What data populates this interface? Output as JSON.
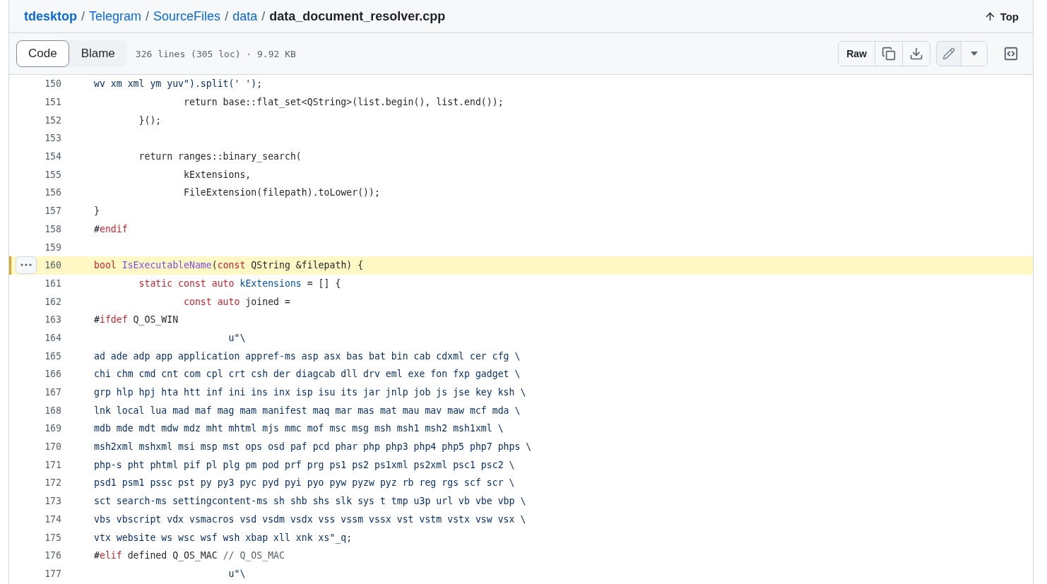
{
  "breadcrumb": {
    "items": [
      {
        "label": "tdesktop",
        "kind": "repo"
      },
      {
        "label": "Telegram",
        "kind": "link"
      },
      {
        "label": "SourceFiles",
        "kind": "link"
      },
      {
        "label": "data",
        "kind": "link"
      }
    ],
    "separator": "/",
    "file": "data_document_resolver.cpp"
  },
  "top_link": "Top",
  "view_tabs": [
    {
      "label": "Code",
      "selected": true
    },
    {
      "label": "Blame",
      "selected": false
    }
  ],
  "file_info": "326 lines (305 loc) · 9.92 KB",
  "raw_button": "Raw",
  "lines": [
    {
      "number": "150",
      "selected": false,
      "tokens": [
        {
          "kind": "string",
          "text": "wv xm xml ym yuv\").split(' ');"
        }
      ]
    },
    {
      "number": "151",
      "selected": false,
      "tokens": [
        {
          "kind": "plain",
          "text": "                return base::flat_set<QString>(list.begin(), list.end());"
        }
      ]
    },
    {
      "number": "152",
      "selected": false,
      "tokens": [
        {
          "kind": "plain",
          "text": "        }();"
        }
      ]
    },
    {
      "number": "153",
      "selected": false
    },
    {
      "number": "154",
      "selected": false,
      "tokens": [
        {
          "kind": "plain",
          "text": "        return ranges::binary_search("
        }
      ]
    },
    {
      "number": "155",
      "selected": false,
      "tokens": [
        {
          "kind": "plain",
          "text": "                kExtensions,"
        }
      ]
    },
    {
      "number": "156",
      "selected": false,
      "tokens": [
        {
          "kind": "plain",
          "text": "                FileExtension(filepath).toLower());"
        }
      ]
    },
    {
      "number": "157",
      "selected": false,
      "tokens": [
        {
          "kind": "plain",
          "text": "}"
        }
      ]
    },
    {
      "number": "158",
      "selected": false,
      "tokens": [
        {
          "kind": "plain",
          "text": "#"
        },
        {
          "kind": "keyword",
          "text": "endif"
        }
      ]
    },
    {
      "number": "159",
      "selected": false
    },
    {
      "number": "160",
      "selected": true,
      "tokens": [
        {
          "kind": "keyword",
          "text": "bool "
        },
        {
          "kind": "function",
          "text": "IsExecutableName"
        },
        {
          "kind": "plain",
          "text": "("
        },
        {
          "kind": "keyword",
          "text": "const"
        },
        {
          "kind": "plain",
          "text": " QString &filepath) {"
        }
      ]
    },
    {
      "number": "161",
      "selected": false,
      "tokens": [
        {
          "kind": "keyword",
          "text": "        static const auto "
        },
        {
          "kind": "constant",
          "text": "kExtensions"
        },
        {
          "kind": "plain",
          "text": " = [] {"
        }
      ]
    },
    {
      "number": "162",
      "selected": false,
      "tokens": [
        {
          "kind": "keyword",
          "text": "                const auto"
        },
        {
          "kind": "plain",
          "text": " joined ="
        }
      ]
    },
    {
      "number": "163",
      "selected": false,
      "tokens": [
        {
          "kind": "plain",
          "text": "#"
        },
        {
          "kind": "keyword",
          "text": "ifdef"
        },
        {
          "kind": "plain",
          "text": " Q_OS_WIN"
        }
      ]
    },
    {
      "number": "164",
      "selected": false,
      "tokens": [
        {
          "kind": "string",
          "text": "                        u\"\\"
        }
      ]
    },
    {
      "number": "165",
      "selected": false,
      "tokens": [
        {
          "kind": "string",
          "text": "ad ade adp app application appref-ms asp asx bas bat bin cab cdxml cer cfg \\"
        }
      ]
    },
    {
      "number": "166",
      "selected": false,
      "tokens": [
        {
          "kind": "string",
          "text": "chi chm cmd cnt com cpl crt csh der diagcab dll drv eml exe fon fxp gadget \\"
        }
      ]
    },
    {
      "number": "167",
      "selected": false,
      "tokens": [
        {
          "kind": "string",
          "text": "grp hlp hpj hta htt inf ini ins inx isp isu its jar jnlp job js jse key ksh \\"
        }
      ]
    },
    {
      "number": "168",
      "selected": false,
      "tokens": [
        {
          "kind": "string",
          "text": "lnk local lua mad maf mag mam manifest maq mar mas mat mau mav maw mcf mda \\"
        }
      ]
    },
    {
      "number": "169",
      "selected": false,
      "tokens": [
        {
          "kind": "string",
          "text": "mdb mde mdt mdw mdz mht mhtml mjs mmc mof msc msg msh msh1 msh2 msh1xml \\"
        }
      ]
    },
    {
      "number": "170",
      "selected": false,
      "tokens": [
        {
          "kind": "string",
          "text": "msh2xml mshxml msi msp mst ops osd paf pcd phar php php3 php4 php5 php7 phps \\"
        }
      ]
    },
    {
      "number": "171",
      "selected": false,
      "tokens": [
        {
          "kind": "string",
          "text": "php-s pht phtml pif pl plg pm pod prf prg ps1 ps2 ps1xml ps2xml psc1 psc2 \\"
        }
      ]
    },
    {
      "number": "172",
      "selected": false,
      "tokens": [
        {
          "kind": "string",
          "text": "psd1 psm1 pssc pst py py3 pyc pyd pyi pyo pyw pyzw pyz rb reg rgs scf scr \\"
        }
      ]
    },
    {
      "number": "173",
      "selected": false,
      "tokens": [
        {
          "kind": "string",
          "text": "sct search-ms settingcontent-ms sh shb shs slk sys t tmp u3p url vb vbe vbp \\"
        }
      ]
    },
    {
      "number": "174",
      "selected": false,
      "tokens": [
        {
          "kind": "string",
          "text": "vbs vbscript vdx vsmacros vsd vsdm vsdx vss vssm vssx vst vstm vstx vsw vsx \\"
        }
      ]
    },
    {
      "number": "175",
      "selected": false,
      "tokens": [
        {
          "kind": "string",
          "text": "vtx website ws wsc wsf wsh xbap xll xnk xs\"_q;"
        }
      ]
    },
    {
      "number": "176",
      "selected": false,
      "tokens": [
        {
          "kind": "plain",
          "text": "#"
        },
        {
          "kind": "keyword",
          "text": "elif"
        },
        {
          "kind": "plain",
          "text": " defined Q_OS_MAC "
        },
        {
          "kind": "comment",
          "text": "// Q_OS_MAC"
        }
      ]
    },
    {
      "number": "177",
      "selected": false,
      "tokens": [
        {
          "kind": "string",
          "text": "                        u\"\\"
        }
      ]
    }
  ]
}
